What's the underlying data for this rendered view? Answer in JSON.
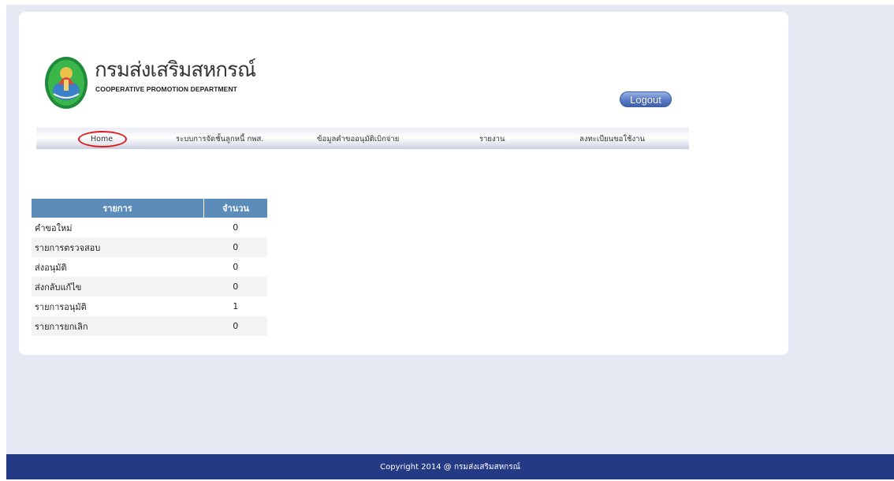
{
  "header": {
    "logo_th": "กรมส่งเสริมสหกรณ์",
    "logo_en": "COOPERATIVE PROMOTION DEPARTMENT",
    "logout_label": "Logout"
  },
  "menu": {
    "items": [
      {
        "label": "Home"
      },
      {
        "label": "ระบบการจัดชั้นลูกหนี้ กพส."
      },
      {
        "label": "ข้อมูลคำขออนุมัติเบิกจ่าย"
      },
      {
        "label": "รายงาน"
      },
      {
        "label": "ลงทะเบียนขอใช้งาน"
      }
    ]
  },
  "summary_table": {
    "headers": {
      "name": "รายการ",
      "count": "จำนวน"
    },
    "rows": [
      {
        "name": "คำขอใหม่",
        "count": "0"
      },
      {
        "name": "รายการตรวจสอบ",
        "count": "0"
      },
      {
        "name": "ส่งอนุมัติ",
        "count": "0"
      },
      {
        "name": "ส่งกลับแก้ไข",
        "count": "0"
      },
      {
        "name": "รายการอนุมัติ",
        "count": "1"
      },
      {
        "name": "รายการยกเลิก",
        "count": "0"
      }
    ]
  },
  "footer": {
    "copyright": "Copyright 2014 @ กรมส่งเสริมสหกรณ์"
  },
  "colors": {
    "footer_bg": "#243a84",
    "table_header_bg": "#5b8cba",
    "page_bg": "#e6e9f4",
    "highlight_circle": "#e01b1b"
  }
}
